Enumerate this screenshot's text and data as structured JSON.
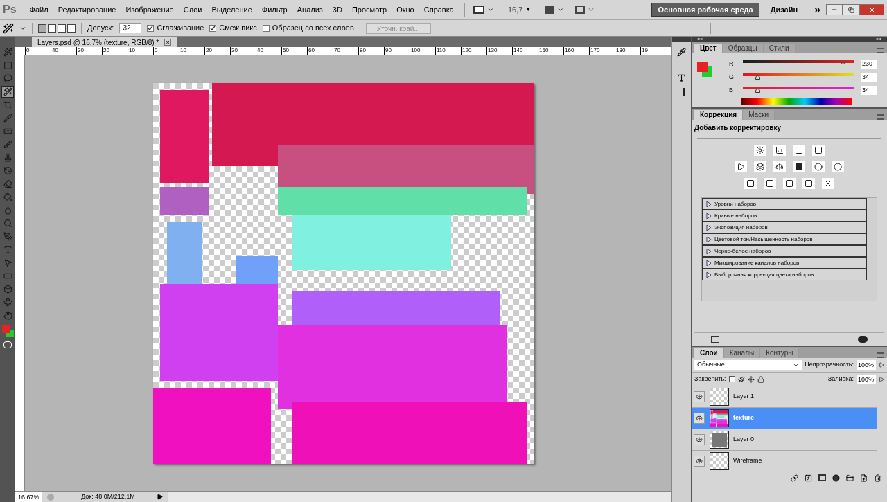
{
  "app_logo": "Ps",
  "menu": [
    "Файл",
    "Редактирование",
    "Изображение",
    "Слои",
    "Выделение",
    "Фильтр",
    "Анализ",
    "3D",
    "Просмотр",
    "Окно",
    "Справка"
  ],
  "zoom_control": {
    "value": "16,7",
    "caret": "▼"
  },
  "workspaces": [
    {
      "label": "Основная рабочая среда",
      "selected": true
    },
    {
      "label": "Дизайн",
      "selected": false
    }
  ],
  "more": "»",
  "options_bar": {
    "tolerance_label": "Допуск:",
    "tolerance": "32",
    "checkboxes": [
      {
        "label": "Сглаживание",
        "checked": true
      },
      {
        "label": "Смеж.пикс",
        "checked": true
      },
      {
        "label": "Образец со всех слоев",
        "checked": false
      }
    ],
    "refine_button": "Уточн. край..."
  },
  "tools": [
    {
      "selected": false
    },
    {
      "selected": false
    },
    {
      "selected": false
    },
    {
      "selected": true
    },
    {
      "selected": false
    },
    {
      "selected": false
    },
    {
      "selected": false
    },
    {
      "selected": false
    },
    {
      "selected": false
    },
    {
      "selected": false
    },
    {
      "selected": false
    },
    {
      "selected": false
    },
    {
      "selected": false
    },
    {
      "selected": false
    },
    {
      "selected": false
    },
    {
      "selected": false
    },
    {
      "selected": false
    },
    {
      "selected": false
    },
    {
      "selected": false
    },
    {
      "selected": false
    },
    {
      "selected": false
    }
  ],
  "swatches": [
    {
      "kind": "foreground",
      "color": "#e62222"
    },
    {
      "kind": "background",
      "color": "#22cc33"
    }
  ],
  "document": {
    "tab_title": "Layers.psd @ 16,7% (texture, RGB/8) *",
    "close": "×",
    "ruler_labels": [
      "0",
      "40",
      "30",
      "20",
      "10",
      "0",
      "10",
      "20",
      "30",
      "40",
      "50",
      "60",
      "70",
      "80",
      "90",
      "100",
      "110",
      "120",
      "130",
      "140",
      "150",
      "160",
      "170",
      "180",
      "19"
    ]
  },
  "status_bar": {
    "zoom": "16,67%",
    "doc_info": "Док: 48,0M/212,1M"
  },
  "panel_strip": {
    "collapse": "««",
    "expand": "»»"
  },
  "color_panel": {
    "tabs": [
      {
        "label": "Цвет",
        "selected": true
      },
      {
        "label": "Образцы",
        "selected": false
      },
      {
        "label": "Стили",
        "selected": false
      }
    ],
    "channels": [
      {
        "name": "R",
        "level": 0.9,
        "value": "230"
      },
      {
        "name": "G",
        "level": 0.133,
        "value": "34"
      },
      {
        "name": "B",
        "level": 0.133,
        "value": "34"
      }
    ]
  },
  "adjustments_panel": {
    "tabs": [
      {
        "label": "Коррекция",
        "selected": true
      },
      {
        "label": "Маски",
        "selected": false
      }
    ],
    "heading": "Добавить корректировку",
    "presets": [
      {
        "label": "Уровни наборов",
        "expanded": false
      },
      {
        "label": "Кривые наборов",
        "expanded": false
      },
      {
        "label": "Экспозиция наборов",
        "expanded": false
      },
      {
        "label": "Цветовой тон/Насыщенность наборов",
        "expanded": false
      },
      {
        "label": "Черно-белое наборов",
        "expanded": false
      },
      {
        "label": "Микширование каналов наборов",
        "expanded": false
      },
      {
        "label": "Выборочная коррекция цвета наборов",
        "expanded": false
      }
    ]
  },
  "layers_panel": {
    "tabs": [
      {
        "label": "Слои",
        "selected": true
      },
      {
        "label": "Каналы",
        "selected": false
      },
      {
        "label": "Контуры",
        "selected": false
      }
    ],
    "blend_mode": "Обычные",
    "opacity_label": "Непрозрачность:",
    "opacity": "100%",
    "lock_label": "Закрепить:",
    "fill_label": "Заливка:",
    "fill": "100%",
    "layers": [
      {
        "name": "Layer 1",
        "kind": "empty",
        "visible": true,
        "selected": false
      },
      {
        "name": "texture",
        "kind": "texture",
        "visible": true,
        "selected": true
      },
      {
        "name": "Layer 0",
        "kind": "gray",
        "visible": true,
        "selected": false
      },
      {
        "name": "Wireframe",
        "kind": "empty",
        "visible": true,
        "selected": false
      }
    ]
  }
}
